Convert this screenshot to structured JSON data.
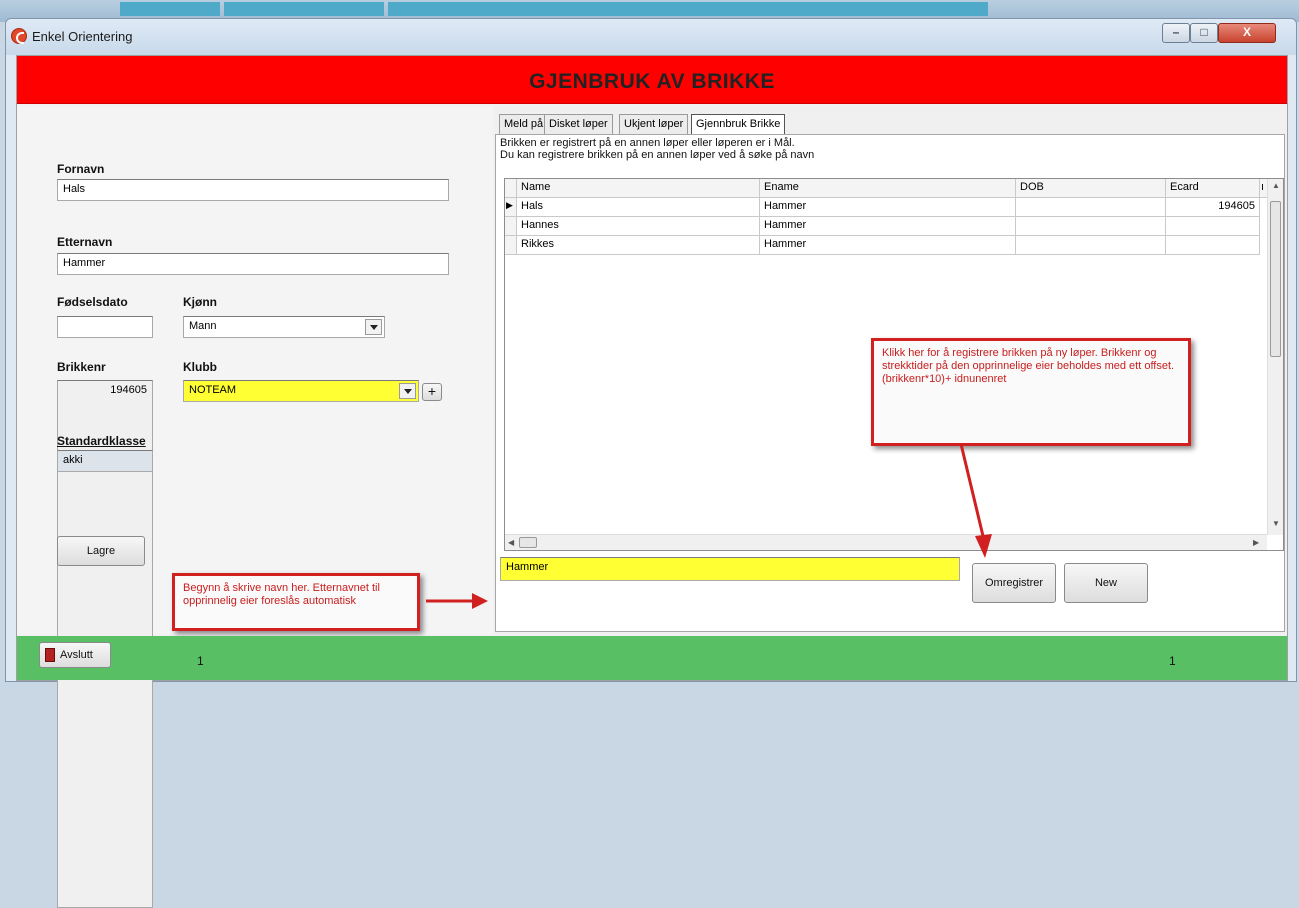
{
  "window": {
    "title": "Enkel Orientering",
    "buttons": {
      "minimize": "–",
      "maximize": "□",
      "close": "X"
    }
  },
  "header": {
    "title": "GJENBRUK AV BRIKKE",
    "color": "#ff0000"
  },
  "form": {
    "fornavn": {
      "label": "Fornavn",
      "value": "Hals"
    },
    "etternavn": {
      "label": "Etternavn",
      "value": "Hammer"
    },
    "fodselsdato": {
      "label": "Fødselsdato",
      "value": ""
    },
    "kjonn": {
      "label": "Kjønn",
      "value": "Mann"
    },
    "brikkenr": {
      "label": "Brikkenr",
      "value": "194605"
    },
    "klubb": {
      "label": "Klubb",
      "value": "NOTEAM",
      "add_label": "+"
    },
    "standardklasse": {
      "label": "Standardklasse",
      "value": "akki"
    },
    "save_label": "Lagre"
  },
  "tabs": [
    "Meld på",
    "Disket løper",
    "Ukjent løper",
    "Gjennbruk Brikke"
  ],
  "active_tab": 3,
  "info_lines": [
    "Brikken er registrert på en annen løper eller løperen er i Mål.",
    "Du kan registrere brikken på en annen løper ved å søke på navn"
  ],
  "grid": {
    "columns": [
      "Name",
      "Ename",
      "DOB",
      "Ecard",
      "ı"
    ],
    "rows": [
      {
        "indicator": "▶",
        "name": "Hals",
        "ename": "Hammer",
        "dob": "",
        "ecard": "194605"
      },
      {
        "indicator": "",
        "name": "Hannes",
        "ename": "Hammer",
        "dob": "",
        "ecard": ""
      },
      {
        "indicator": "",
        "name": "Rikkes",
        "ename": "Hammer",
        "dob": "",
        "ecard": ""
      }
    ]
  },
  "search": {
    "value": "Hammer"
  },
  "actions": {
    "reregister_label": "Omregistrer",
    "new_label": "New"
  },
  "callouts": {
    "name": "Begynn å skrive navn her. Etternavnet til opprinnelig eier foreslås automatisk",
    "reregister": "Klikk her for å registrere brikken på ny løper. Brikkenr og strekktider på den opprinnelige eier beholdes med ett offset. (brikkenr*10)+ idnunenret"
  },
  "status": {
    "exit_label": "Avslutt",
    "left_count": "1",
    "right_count": "1",
    "color": "#58bf64"
  }
}
